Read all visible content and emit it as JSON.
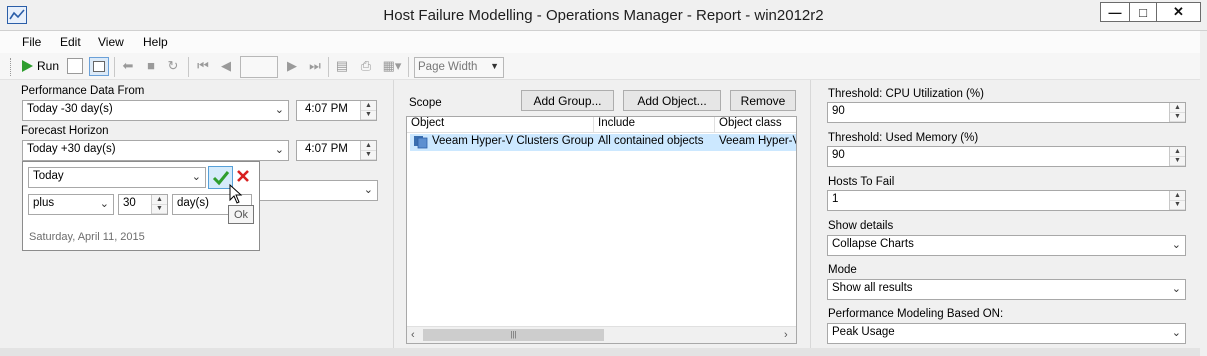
{
  "window": {
    "title": "Host Failure Modelling - Operations Manager - Report - win2012r2",
    "minimize": "—",
    "maximize": "□",
    "close": "✕"
  },
  "menu": [
    "File",
    "Edit",
    "View",
    "Help"
  ],
  "toolbar": {
    "run_label": "Run",
    "page_number": "",
    "zoom": "Page Width"
  },
  "left": {
    "perf_label": "Performance Data From",
    "perf_value": "Today -30 day(s)",
    "perf_time": "4:07 PM",
    "forecast_label": "Forecast Horizon",
    "forecast_value": "Today +30 day(s)",
    "forecast_time": "4:07 PM",
    "popup": {
      "base": "Today",
      "operator": "plus",
      "amount": "30",
      "unit": "day(s)",
      "date_text": "Saturday, April 11, 2015",
      "tooltip": "Ok"
    }
  },
  "scope": {
    "label": "Scope",
    "add_group": "Add Group...",
    "add_object": "Add Object...",
    "remove": "Remove",
    "columns": [
      "Object",
      "Include",
      "Object class"
    ],
    "rows": [
      {
        "object": "Veeam Hyper-V Clusters Group",
        "include": "All contained objects",
        "class": "Veeam Hyper-V"
      }
    ],
    "scroll_thumb": "|||"
  },
  "right": {
    "cpu_label": "Threshold: CPU Utilization (%)",
    "cpu_value": "90",
    "mem_label": "Threshold: Used Memory (%)",
    "mem_value": "90",
    "hosts_label": "Hosts To Fail",
    "hosts_value": "1",
    "details_label": "Show details",
    "details_value": "Collapse Charts",
    "mode_label": "Mode",
    "mode_value": "Show all results",
    "basis_label": "Performance Modeling Based ON:",
    "basis_value": "Peak Usage"
  },
  "colors": {
    "accent": "#2b5ea8",
    "selection": "#cce8ff",
    "ok_green": "#2e9e2e",
    "cancel_red": "#d82020"
  }
}
